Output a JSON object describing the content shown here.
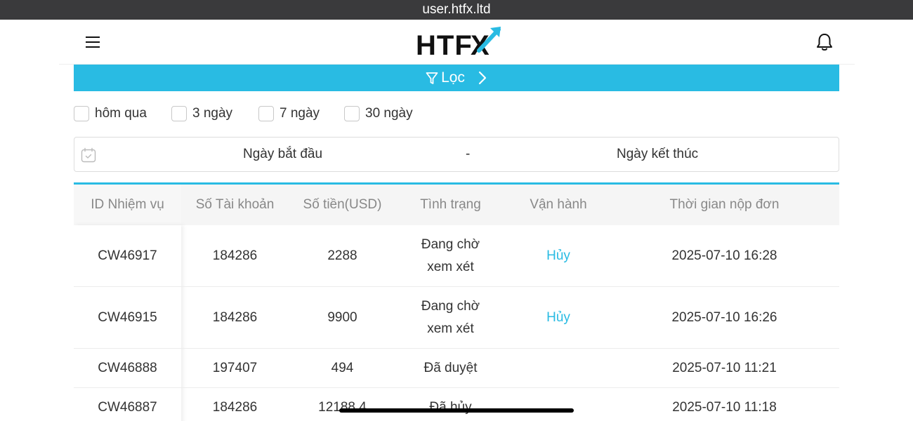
{
  "browser": {
    "url": "user.htfx.ltd"
  },
  "header": {
    "logo_text": "HTFX",
    "menu_icon": "hamburger-icon",
    "notification_icon": "bell-icon"
  },
  "filter": {
    "label": "Lọc",
    "icon": "filter-icon",
    "expand_icon": "chevron-right-icon"
  },
  "quick_ranges": [
    {
      "label": "hôm qua",
      "checked": false
    },
    {
      "label": "3 ngày",
      "checked": false
    },
    {
      "label": "7 ngày",
      "checked": false
    },
    {
      "label": "30 ngày",
      "checked": false
    }
  ],
  "date_range": {
    "start_label": "Ngày bắt đầu",
    "separator": "-",
    "end_label": "Ngày kết thúc",
    "icon": "calendar-icon"
  },
  "table": {
    "columns": [
      "ID Nhiệm vụ",
      "Số Tài khoản",
      "Số tiền(USD)",
      "Tình trạng",
      "Vận hành",
      "Thời gian nộp đơn"
    ],
    "rows": [
      {
        "id": "CW46917",
        "account": "184286",
        "amount": "2288",
        "status": "Đang chờ xem xét",
        "action": "Hủy",
        "time": "2025-07-10 16:28"
      },
      {
        "id": "CW46915",
        "account": "184286",
        "amount": "9900",
        "status": "Đang chờ xem xét",
        "action": "Hủy",
        "time": "2025-07-10 16:26"
      },
      {
        "id": "CW46888",
        "account": "197407",
        "amount": "494",
        "status": "Đã duyệt",
        "action": "",
        "time": "2025-07-10 11:21"
      },
      {
        "id": "CW46887",
        "account": "184286",
        "amount": "12188.4",
        "status": "Đã hủy",
        "action": "",
        "time": "2025-07-10 11:18"
      }
    ]
  },
  "colors": {
    "accent": "#29bbe3",
    "logo_dark": "#111111",
    "url_bar_bg": "#3a3a3c"
  }
}
